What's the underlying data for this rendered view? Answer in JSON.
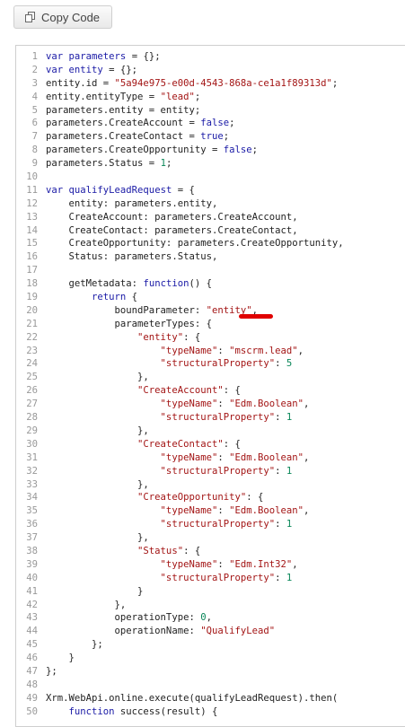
{
  "toolbar": {
    "copy_label": "Copy Code",
    "copy_icon": "copy-icon"
  },
  "code_lines": [
    {
      "n": "1",
      "parts": [
        [
          "kw",
          "var"
        ],
        [
          "",
          ""
        ],
        [
          "kw",
          " parameters"
        ],
        [
          "",
          " = {};"
        ]
      ]
    },
    {
      "n": "2",
      "parts": [
        [
          "kw",
          "var"
        ],
        [
          "kw",
          " entity"
        ],
        [
          "",
          " = {};"
        ]
      ]
    },
    {
      "n": "3",
      "parts": [
        [
          "",
          "entity.id = "
        ],
        [
          "str",
          "\"5a94e975-e00d-4543-868a-ce1a1f89313d\""
        ],
        [
          "",
          ";"
        ]
      ]
    },
    {
      "n": "4",
      "parts": [
        [
          "",
          "entity.entityType = "
        ],
        [
          "str",
          "\"lead\""
        ],
        [
          "",
          ";"
        ]
      ]
    },
    {
      "n": "5",
      "parts": [
        [
          "",
          "parameters.entity = entity;"
        ]
      ]
    },
    {
      "n": "6",
      "parts": [
        [
          "",
          "parameters.CreateAccount = "
        ],
        [
          "kw",
          "false"
        ],
        [
          "",
          ";"
        ]
      ]
    },
    {
      "n": "7",
      "parts": [
        [
          "",
          "parameters.CreateContact = "
        ],
        [
          "kw",
          "true"
        ],
        [
          "",
          ";"
        ]
      ]
    },
    {
      "n": "8",
      "parts": [
        [
          "",
          "parameters.CreateOpportunity = "
        ],
        [
          "kw",
          "false"
        ],
        [
          "",
          ";"
        ]
      ]
    },
    {
      "n": "9",
      "parts": [
        [
          "",
          "parameters.Status = "
        ],
        [
          "num",
          "1"
        ],
        [
          "",
          ";"
        ]
      ]
    },
    {
      "n": "10",
      "parts": []
    },
    {
      "n": "11",
      "parts": [
        [
          "kw",
          "var"
        ],
        [
          "kw",
          " qualifyLeadRequest"
        ],
        [
          "",
          " = {"
        ]
      ]
    },
    {
      "n": "12",
      "parts": [
        [
          "",
          "    entity: parameters.entity,"
        ]
      ]
    },
    {
      "n": "13",
      "parts": [
        [
          "",
          "    CreateAccount: parameters.CreateAccount,"
        ]
      ]
    },
    {
      "n": "14",
      "parts": [
        [
          "",
          "    CreateContact: parameters.CreateContact,"
        ]
      ]
    },
    {
      "n": "15",
      "parts": [
        [
          "",
          "    CreateOpportunity: parameters.CreateOpportunity,"
        ]
      ]
    },
    {
      "n": "16",
      "parts": [
        [
          "",
          "    Status: parameters.Status,"
        ]
      ]
    },
    {
      "n": "17",
      "parts": []
    },
    {
      "n": "18",
      "parts": [
        [
          "",
          "    getMetadata: "
        ],
        [
          "kw",
          "function"
        ],
        [
          "",
          "() {"
        ]
      ]
    },
    {
      "n": "19",
      "parts": [
        [
          "kw",
          "        return"
        ],
        [
          "",
          " {"
        ]
      ]
    },
    {
      "n": "20",
      "parts": [
        [
          "",
          "            boundParameter: "
        ],
        [
          "str",
          "\"entity\""
        ],
        [
          "",
          ","
        ]
      ]
    },
    {
      "n": "21",
      "parts": [
        [
          "",
          "            parameterTypes: {"
        ]
      ]
    },
    {
      "n": "22",
      "parts": [
        [
          "str",
          "                \"entity\""
        ],
        [
          "",
          ": {"
        ]
      ]
    },
    {
      "n": "23",
      "parts": [
        [
          "str",
          "                    \"typeName\""
        ],
        [
          "",
          ": "
        ],
        [
          "str",
          "\"mscrm.lead\""
        ],
        [
          "",
          ","
        ]
      ]
    },
    {
      "n": "24",
      "parts": [
        [
          "str",
          "                    \"structuralProperty\""
        ],
        [
          "",
          ": "
        ],
        [
          "num",
          "5"
        ]
      ]
    },
    {
      "n": "25",
      "parts": [
        [
          "",
          "                },"
        ]
      ]
    },
    {
      "n": "26",
      "parts": [
        [
          "str",
          "                \"CreateAccount\""
        ],
        [
          "",
          ": {"
        ]
      ]
    },
    {
      "n": "27",
      "parts": [
        [
          "str",
          "                    \"typeName\""
        ],
        [
          "",
          ": "
        ],
        [
          "str",
          "\"Edm.Boolean\""
        ],
        [
          "",
          ","
        ]
      ]
    },
    {
      "n": "28",
      "parts": [
        [
          "str",
          "                    \"structuralProperty\""
        ],
        [
          "",
          ": "
        ],
        [
          "num",
          "1"
        ]
      ]
    },
    {
      "n": "29",
      "parts": [
        [
          "",
          "                },"
        ]
      ]
    },
    {
      "n": "30",
      "parts": [
        [
          "str",
          "                \"CreateContact\""
        ],
        [
          "",
          ": {"
        ]
      ]
    },
    {
      "n": "31",
      "parts": [
        [
          "str",
          "                    \"typeName\""
        ],
        [
          "",
          ": "
        ],
        [
          "str",
          "\"Edm.Boolean\""
        ],
        [
          "",
          ","
        ]
      ]
    },
    {
      "n": "32",
      "parts": [
        [
          "str",
          "                    \"structuralProperty\""
        ],
        [
          "",
          ": "
        ],
        [
          "num",
          "1"
        ]
      ]
    },
    {
      "n": "33",
      "parts": [
        [
          "",
          "                },"
        ]
      ]
    },
    {
      "n": "34",
      "parts": [
        [
          "str",
          "                \"CreateOpportunity\""
        ],
        [
          "",
          ": {"
        ]
      ]
    },
    {
      "n": "35",
      "parts": [
        [
          "str",
          "                    \"typeName\""
        ],
        [
          "",
          ": "
        ],
        [
          "str",
          "\"Edm.Boolean\""
        ],
        [
          "",
          ","
        ]
      ]
    },
    {
      "n": "36",
      "parts": [
        [
          "str",
          "                    \"structuralProperty\""
        ],
        [
          "",
          ": "
        ],
        [
          "num",
          "1"
        ]
      ]
    },
    {
      "n": "37",
      "parts": [
        [
          "",
          "                },"
        ]
      ]
    },
    {
      "n": "38",
      "parts": [
        [
          "str",
          "                \"Status\""
        ],
        [
          "",
          ": {"
        ]
      ]
    },
    {
      "n": "39",
      "parts": [
        [
          "str",
          "                    \"typeName\""
        ],
        [
          "",
          ": "
        ],
        [
          "str",
          "\"Edm.Int32\""
        ],
        [
          "",
          ","
        ]
      ]
    },
    {
      "n": "40",
      "parts": [
        [
          "str",
          "                    \"structuralProperty\""
        ],
        [
          "",
          ": "
        ],
        [
          "num",
          "1"
        ]
      ]
    },
    {
      "n": "41",
      "parts": [
        [
          "",
          "                }"
        ]
      ]
    },
    {
      "n": "42",
      "parts": [
        [
          "",
          "            },"
        ]
      ]
    },
    {
      "n": "43",
      "parts": [
        [
          "",
          "            operationType: "
        ],
        [
          "num",
          "0"
        ],
        [
          "",
          ","
        ]
      ]
    },
    {
      "n": "44",
      "parts": [
        [
          "",
          "            operationName: "
        ],
        [
          "str",
          "\"QualifyLead\""
        ]
      ]
    },
    {
      "n": "45",
      "parts": [
        [
          "",
          "        };"
        ]
      ]
    },
    {
      "n": "46",
      "parts": [
        [
          "",
          "    }"
        ]
      ]
    },
    {
      "n": "47",
      "parts": [
        [
          "",
          "};"
        ]
      ]
    },
    {
      "n": "48",
      "parts": []
    },
    {
      "n": "49",
      "parts": [
        [
          "",
          "Xrm.WebApi.online.execute(qualifyLeadRequest).then("
        ]
      ]
    },
    {
      "n": "50",
      "parts": [
        [
          "kw",
          "    function"
        ],
        [
          "",
          " success(result) {"
        ]
      ]
    }
  ],
  "highlight": {
    "color": "#e00000",
    "target": "entity"
  }
}
